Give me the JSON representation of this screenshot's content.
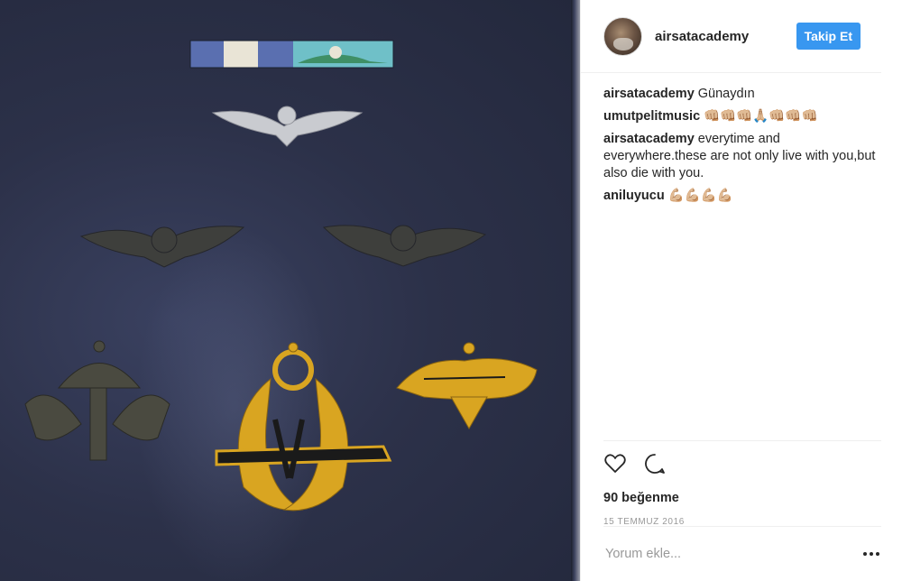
{
  "post": {
    "username": "airsatacademy",
    "follow_label": "Takip Et",
    "avatar_icon": "avatar-icon"
  },
  "comments": [
    {
      "author": "airsatacademy",
      "text": "Günaydın"
    },
    {
      "author": "umutpelitmusic",
      "text": "👊🏼👊🏼👊🏼🙏🏼👊🏼👊🏼👊🏼"
    },
    {
      "author": "airsatacademy",
      "text": "everytime and everywhere.these are not only live with you,but also die with you."
    },
    {
      "author": "aniluyucu",
      "text": "💪🏼💪🏼💪🏼💪🏼"
    }
  ],
  "actions": {
    "like_icon": "heart-icon",
    "comment_icon": "comment-icon",
    "likes_text": "90 beğenme",
    "date_text": "15 TEMMUZ 2016"
  },
  "add_comment": {
    "placeholder": "Yorum ekle...",
    "more_icon": "ellipsis-icon"
  },
  "colors": {
    "follow_button": "#3897f0",
    "photo_background": "#2c3149",
    "gold_badge": "#d9a521",
    "silver_badge": "#c9cbd0",
    "bronze_badge": "#4a4a40"
  }
}
